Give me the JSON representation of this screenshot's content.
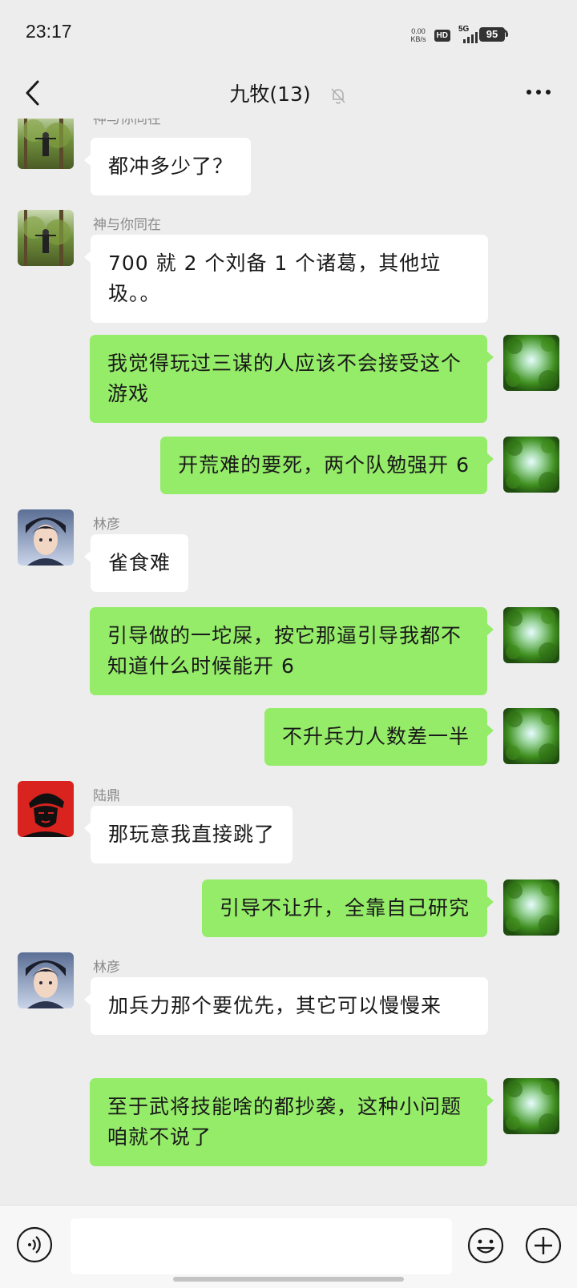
{
  "status_bar": {
    "time": "23:17",
    "speed_value": "0.00",
    "speed_unit": "KB/s",
    "hd": "HD",
    "network": "5G",
    "battery": "95"
  },
  "header": {
    "title": "九牧(13)",
    "back_icon": "chevron-left-icon",
    "mute_icon": "bell-off-icon",
    "more_icon": "more-dots-icon"
  },
  "messages": [
    {
      "side": "left",
      "sender": "神与你同在",
      "text": "都冲多少了？",
      "avatar": "forest-person-avatar"
    },
    {
      "side": "left",
      "sender": "神与你同在",
      "text": "700 就 2 个刘备 1 个诸葛，其他垃圾。。",
      "avatar": "forest-person-avatar"
    },
    {
      "side": "right",
      "text": "我觉得玩过三谋的人应该不会接受这个游戏",
      "avatar": "green-leaves-avatar"
    },
    {
      "side": "right",
      "text": "开荒难的要死，两个队勉强开 6",
      "avatar": "green-leaves-avatar"
    },
    {
      "side": "left",
      "sender": "林彦",
      "text": "雀食难",
      "avatar": "anime-boy-avatar"
    },
    {
      "side": "right",
      "text": "引导做的一坨屎，按它那逼引导我都不知道什么时候能开 6",
      "avatar": "green-leaves-avatar"
    },
    {
      "side": "right",
      "text": "不升兵力人数差一半",
      "avatar": "green-leaves-avatar"
    },
    {
      "side": "left",
      "sender": "陆鼎",
      "text": "那玩意我直接跳了",
      "avatar": "red-portrait-avatar"
    },
    {
      "side": "right",
      "text": "引导不让升，全靠自己研究",
      "avatar": "green-leaves-avatar"
    },
    {
      "side": "left",
      "sender": "林彦",
      "text": "加兵力那个要优先，其它可以慢慢来",
      "avatar": "anime-boy-avatar"
    },
    {
      "side": "right",
      "text": "至于武将技能啥的都抄袭，这种小问题咱就不说了",
      "avatar": "green-leaves-avatar"
    }
  ],
  "input_bar": {
    "voice_icon": "voice-icon",
    "emoji_icon": "emoji-icon",
    "plus_icon": "plus-circle-icon",
    "input_value": ""
  },
  "colors": {
    "background": "#ededed",
    "self_bubble": "#95ec69",
    "other_bubble": "#ffffff",
    "sender_name": "#8a8a8a"
  }
}
